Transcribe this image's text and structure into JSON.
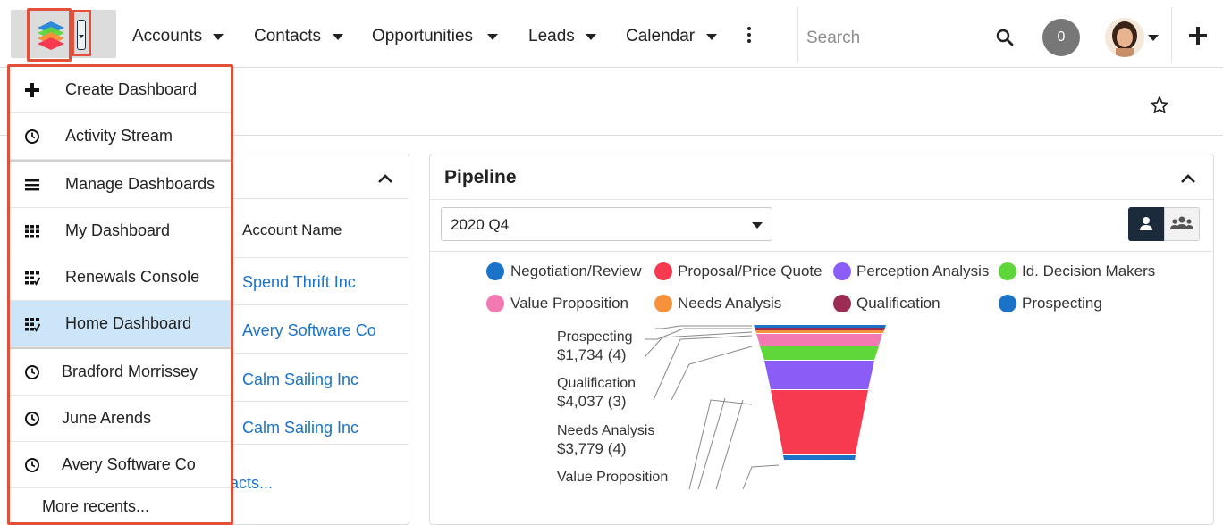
{
  "nav": {
    "items": [
      {
        "label": "Accounts"
      },
      {
        "label": "Contacts"
      },
      {
        "label": "Opportunities"
      },
      {
        "label": "Leads"
      },
      {
        "label": "Calendar"
      }
    ],
    "search_placeholder": "Search",
    "notification_count": "0"
  },
  "menu": {
    "items": [
      {
        "label": "Create Dashboard",
        "icon": "plus-icon"
      },
      {
        "label": "Activity Stream",
        "icon": "clock-icon"
      },
      {
        "label": "Manage Dashboards",
        "icon": "list-icon"
      },
      {
        "label": "My Dashboard",
        "icon": "grid-icon"
      },
      {
        "label": "Renewals Console",
        "icon": "grid-check-icon"
      },
      {
        "label": "Home Dashboard",
        "icon": "grid-check-icon",
        "active": true
      },
      {
        "label": "Bradford Morrissey",
        "icon": "clock-icon"
      },
      {
        "label": "June Arends",
        "icon": "clock-icon"
      },
      {
        "label": "Avery Software Co",
        "icon": "clock-icon"
      },
      {
        "label": "More recents..."
      }
    ]
  },
  "left_dashlet": {
    "column_header": "Account Name",
    "rows": [
      "Spend Thrift Inc",
      "Avery Software Co",
      "Calm Sailing Inc",
      "Calm Sailing Inc"
    ],
    "more_link": "acts..."
  },
  "pipeline": {
    "title": "Pipeline",
    "period": "2020 Q4"
  },
  "chart_data": {
    "type": "funnel",
    "legend": [
      {
        "name": "Negotiation/Review",
        "color": "#1a73c9"
      },
      {
        "name": "Proposal/Price Quote",
        "color": "#f73a50"
      },
      {
        "name": "Perception Analysis",
        "color": "#8b5cf6"
      },
      {
        "name": "Id. Decision Makers",
        "color": "#5fd63a"
      },
      {
        "name": "Value Proposition",
        "color": "#f279b1"
      },
      {
        "name": "Needs Analysis",
        "color": "#f6913c"
      },
      {
        "name": "Qualification",
        "color": "#9b2d55"
      },
      {
        "name": "Prospecting",
        "color": "#1a73c9"
      }
    ],
    "labels": [
      {
        "stage": "Prospecting",
        "value": "$1,734 (4)"
      },
      {
        "stage": "Qualification",
        "value": "$4,037 (3)"
      },
      {
        "stage": "Needs Analysis",
        "value": "$3,779 (4)"
      },
      {
        "stage": "Value Proposition",
        "value": ""
      }
    ]
  }
}
